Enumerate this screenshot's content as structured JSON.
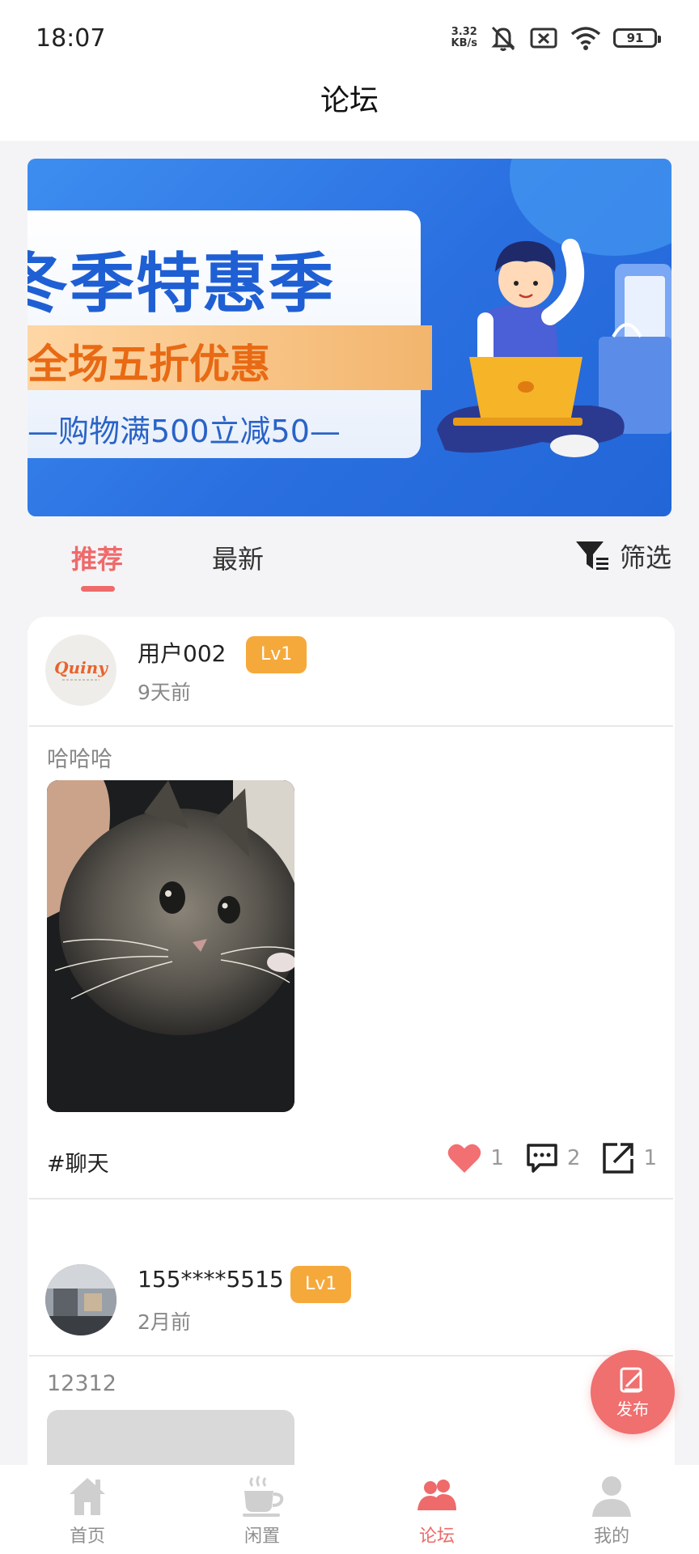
{
  "status_bar": {
    "time": "18:07",
    "net_speed_value": "3.32",
    "net_speed_unit": "KB/s",
    "battery": "91",
    "icons": [
      "mute-bell-icon",
      "sim-error-icon",
      "wifi-icon",
      "battery-icon"
    ]
  },
  "header": {
    "title": "论坛"
  },
  "banner": {
    "title": "冬季特惠季",
    "subtitle": "全场五折优惠",
    "promo_line": "—购物满500立减50—"
  },
  "tabs": [
    {
      "label": "推荐",
      "active": true
    },
    {
      "label": "最新",
      "active": false
    }
  ],
  "filter": {
    "label": "筛选",
    "icon": "filter-icon"
  },
  "posts": [
    {
      "user_name": "用户002",
      "level": "Lv1",
      "time": "9天前",
      "text": "哈哈哈",
      "image": "kitten-photo",
      "tag": "#聊天",
      "likes": "1",
      "comments": "2",
      "shares": "1"
    },
    {
      "user_name": "155****5515",
      "level": "Lv1",
      "time": "2月前",
      "text": "12312"
    }
  ],
  "fab": {
    "label": "发布",
    "icon": "edit-icon"
  },
  "bottom_nav": [
    {
      "label": "首页",
      "icon": "home-icon",
      "active": false
    },
    {
      "label": "闲置",
      "icon": "coffee-cup-icon",
      "active": false
    },
    {
      "label": "论坛",
      "icon": "forum-users-icon",
      "active": true
    },
    {
      "label": "我的",
      "icon": "user-icon",
      "active": false
    }
  ],
  "colors": {
    "accent": "#ef6a6a",
    "badge": "#f6a93b",
    "banner_blue": "#2a6fe0"
  }
}
